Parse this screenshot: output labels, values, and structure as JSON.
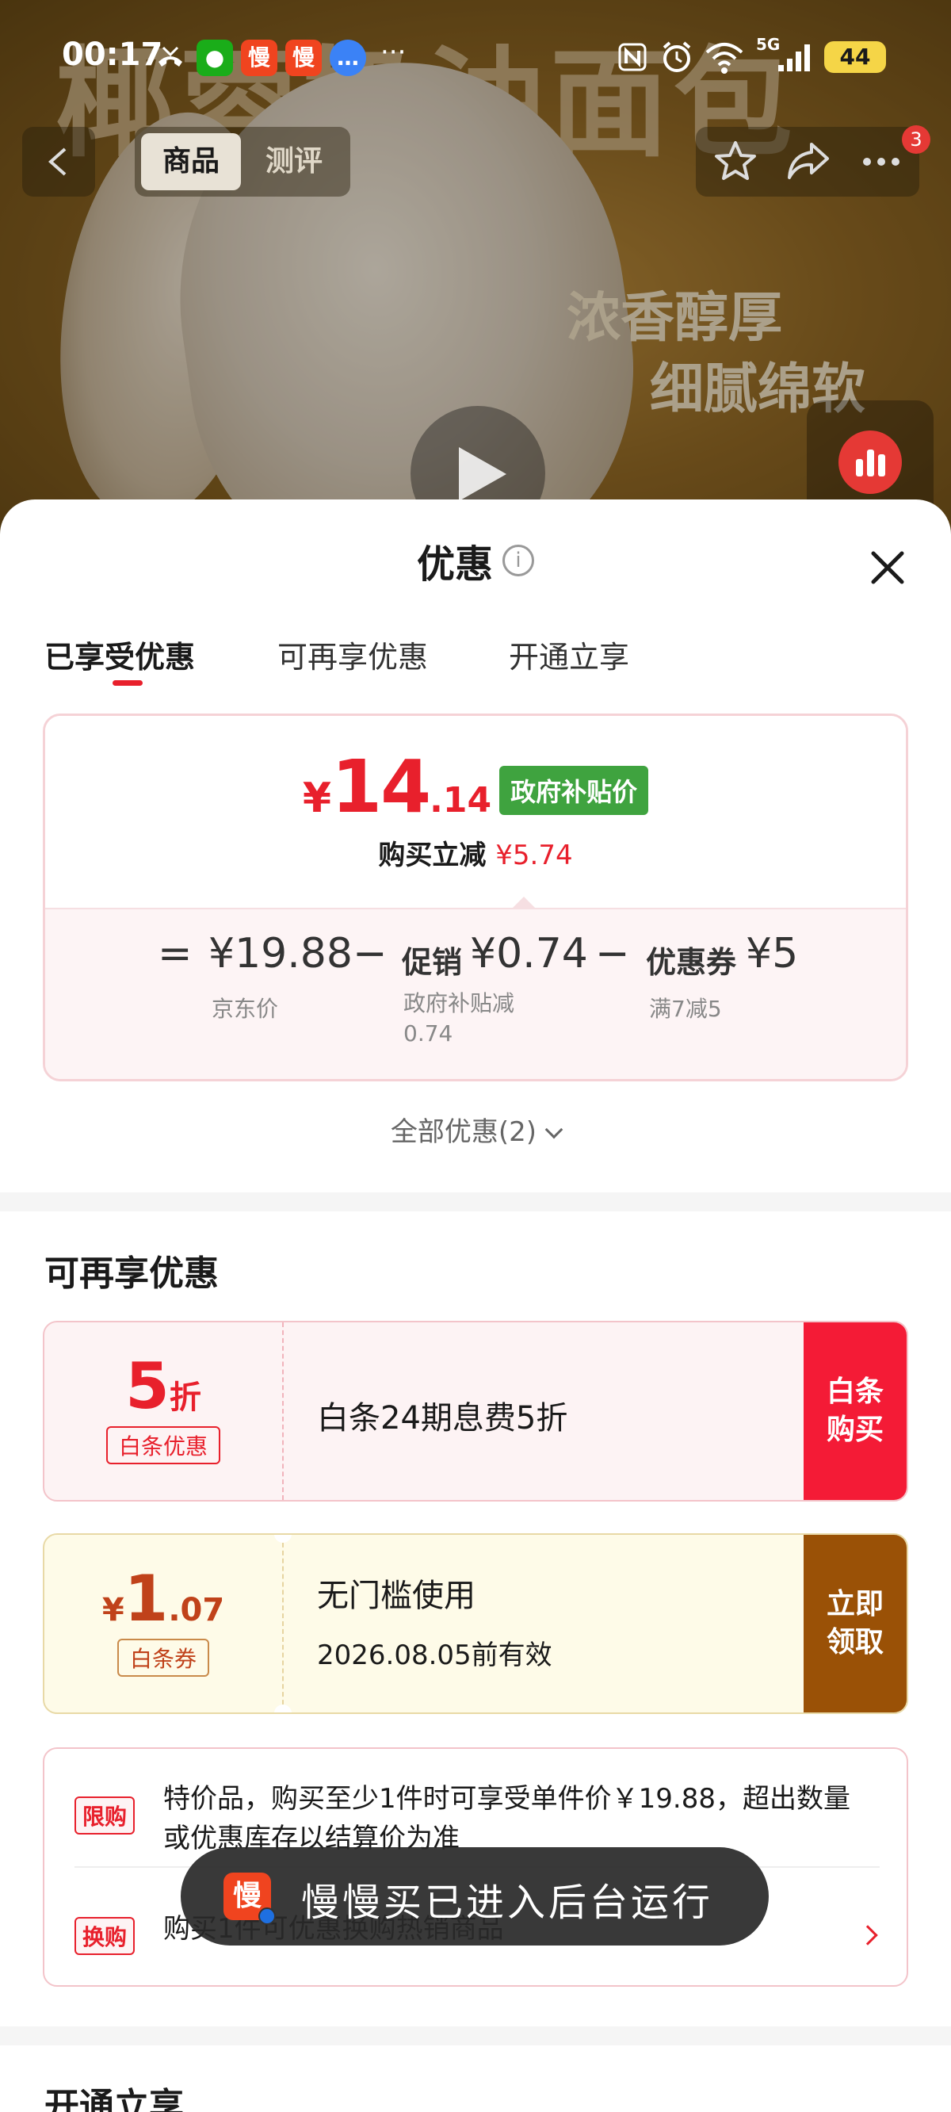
{
  "status_bar": {
    "time": "00:17",
    "overflow": "···",
    "network": "5G",
    "battery": "44",
    "app_icons": [
      "missed-call-icon",
      "wechat-icon",
      "manman-icon",
      "manman-icon",
      "message-icon"
    ],
    "right_icons": [
      "nfc-icon",
      "alarm-icon",
      "wifi-icon",
      "signal-icon"
    ]
  },
  "hero": {
    "title_art": "椰蓉奶油面包",
    "slogan_1": "浓香醇厚",
    "slogan_2": "细腻绵软"
  },
  "top_nav": {
    "tab_product": "商品",
    "tab_review": "测评",
    "badge": "3"
  },
  "sheet": {
    "title": "优惠",
    "info_icon": "i",
    "tabs": [
      "已享受优惠",
      "可再享优惠",
      "开通立享"
    ],
    "active_tab": 0
  },
  "price_card": {
    "yen": "¥",
    "price_int": "14",
    "price_dec": ".14",
    "tag": "政府补贴价",
    "reduce_label": "购买立减",
    "reduce_amount": "¥5.74",
    "equals": "=",
    "minus": "−",
    "jd_price": "¥19.88",
    "jd_label": "京东价",
    "promo_label": "促销",
    "promo_amount": "¥0.74",
    "promo_sub": "政府补贴减0.74",
    "coupon_label": "优惠券",
    "coupon_amount": "¥5",
    "coupon_sub": "满7减5"
  },
  "all_promos": "全部优惠(2)",
  "section_more": {
    "title": "可再享优惠",
    "coupons": [
      {
        "big": "5",
        "unit": "折",
        "tag": "白条优惠",
        "text": "白条24期息费5折",
        "button": "白条购买"
      },
      {
        "prefix": "¥",
        "big": "1",
        "unit": ".07",
        "tag": "白条券",
        "text": "无门槛使用",
        "sub": "2026.08.05前有效",
        "button": "立即领取"
      }
    ]
  },
  "rules": [
    {
      "tag": "限购",
      "text": "特价品，购买至少1件时可享受单件价￥19.88，超出数量或优惠库存以结算价为准"
    },
    {
      "tag": "换购",
      "text": "购买1件可优惠换购热销商品"
    }
  ],
  "section_join": {
    "title": "开通立享"
  },
  "toast": {
    "icon_text": "慢",
    "text": "慢慢买已进入后台运行"
  }
}
